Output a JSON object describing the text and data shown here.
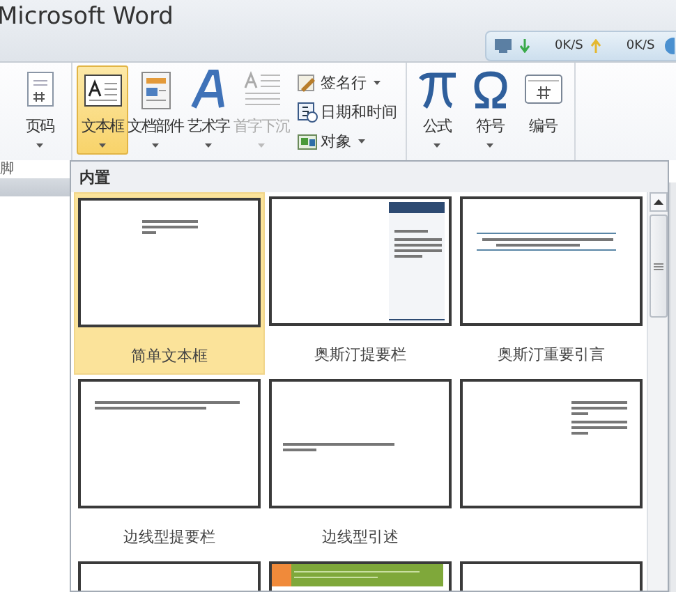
{
  "window": {
    "title": "Microsoft Word"
  },
  "network_monitor": {
    "download": "0K/S",
    "upload": "0K/S"
  },
  "ribbon": {
    "group_label": "脚",
    "groups": [
      {
        "items": [
          {
            "label": "页码",
            "kind": "large",
            "dropdown": true,
            "selected": false,
            "disabled": false
          }
        ]
      },
      {
        "items": [
          {
            "label": "文本框",
            "kind": "large",
            "dropdown": true,
            "selected": true,
            "disabled": false
          },
          {
            "label": "文档部件",
            "kind": "large",
            "dropdown": true,
            "selected": false,
            "disabled": false
          },
          {
            "label": "艺术字",
            "kind": "large",
            "dropdown": true,
            "selected": false,
            "disabled": false
          },
          {
            "label": "首字下沉",
            "kind": "large",
            "dropdown": true,
            "selected": false,
            "disabled": true
          },
          {
            "label": "签名行",
            "kind": "small",
            "dropdown": true,
            "selected": false,
            "disabled": false
          },
          {
            "label": "日期和时间",
            "kind": "small",
            "dropdown": false,
            "selected": false,
            "disabled": false
          },
          {
            "label": "对象",
            "kind": "small",
            "dropdown": true,
            "selected": false,
            "disabled": false
          }
        ]
      },
      {
        "items": [
          {
            "label": "公式",
            "kind": "large",
            "dropdown": true,
            "selected": false,
            "disabled": false
          },
          {
            "label": "符号",
            "kind": "large",
            "dropdown": true,
            "selected": false,
            "disabled": false
          },
          {
            "label": "编号",
            "kind": "large",
            "dropdown": false,
            "selected": false,
            "disabled": false
          }
        ]
      }
    ]
  },
  "gallery": {
    "heading": "内置",
    "items": [
      {
        "label": "简单文本框",
        "kind": "simple",
        "selected": true
      },
      {
        "label": "奥斯汀提要栏",
        "kind": "sidebar",
        "selected": false
      },
      {
        "label": "奥斯汀重要引言",
        "kind": "quote",
        "selected": false
      },
      {
        "label": "边线型提要栏",
        "kind": "text-top",
        "selected": false
      },
      {
        "label": "边线型引述",
        "kind": "text-middle",
        "selected": false
      },
      {
        "kind": "text-right",
        "selected": false
      },
      {
        "kind": "blank",
        "selected": false
      },
      {
        "kind": "banner",
        "selected": false
      },
      {
        "kind": "blank",
        "selected": false
      }
    ]
  }
}
